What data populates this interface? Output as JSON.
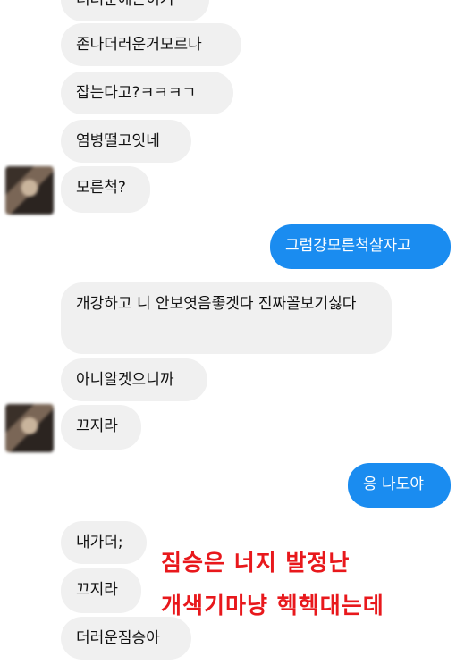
{
  "messages": [
    {
      "text": "더러운에는이거",
      "direction": "incoming"
    },
    {
      "text": "존나더러운거모르나",
      "direction": "incoming"
    },
    {
      "text": "잡는다고?ㅋㅋㅋㄱ",
      "direction": "incoming"
    },
    {
      "text": "염병떨고잇네",
      "direction": "incoming"
    },
    {
      "text": "모른척?",
      "direction": "incoming"
    },
    {
      "text": "그럼걍모른척살자고",
      "direction": "outgoing"
    },
    {
      "text": "개강하고 니 안보엿음좋겟다 진짜꼴보기싫다",
      "direction": "incoming"
    },
    {
      "text": "아니알겟으니까",
      "direction": "incoming"
    },
    {
      "text": "끄지라",
      "direction": "incoming"
    },
    {
      "text": "응 나도야",
      "direction": "outgoing"
    },
    {
      "text": "내가더;",
      "direction": "incoming"
    },
    {
      "text": "끄지라",
      "direction": "incoming"
    },
    {
      "text": "더러운짐승아",
      "direction": "incoming"
    }
  ],
  "caption": {
    "line1": "짐승은 너지 발정난",
    "line2": "개색기마냥 헥헥대는데",
    "color": "#e8181c"
  },
  "colors": {
    "incoming_bubble": "#f0f0f0",
    "outgoing_bubble": "#1a8cf0"
  }
}
